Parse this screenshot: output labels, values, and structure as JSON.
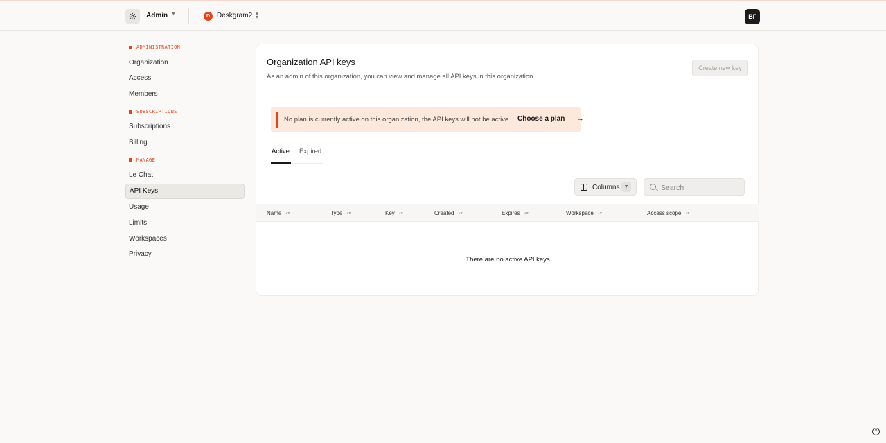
{
  "header": {
    "workspace_label": "Admin",
    "org_initial": "D",
    "org_name": "Deskgram2",
    "user_initials": "ВГ",
    "accent_color": "#e8421b"
  },
  "sidebar": {
    "sections": [
      {
        "title": "ADMINISTRATION",
        "items": [
          "Organization",
          "Access",
          "Members"
        ]
      },
      {
        "title": "SUBSCRIPTIONS",
        "items": [
          "Subscriptions",
          "Billing"
        ]
      },
      {
        "title": "MANAGE",
        "items": [
          "Le Chat",
          "API Keys",
          "Usage",
          "Limits",
          "Workspaces",
          "Privacy"
        ]
      }
    ],
    "active_item": "API Keys"
  },
  "main": {
    "title": "Organization API keys",
    "subtitle": "As an admin of this organization, you can view and manage all API keys in this organization.",
    "create_button": "Create new key",
    "alert": {
      "text": "No plan is currently active on this organization, the API keys will not be active.",
      "link": "Choose a plan"
    },
    "tabs": [
      "Active",
      "Expired"
    ],
    "active_tab": "Active",
    "columns_button": "Columns",
    "columns_count": "7",
    "search_placeholder": "Search",
    "table": {
      "headers": [
        "Name",
        "Type",
        "Key",
        "Created",
        "Expires",
        "Workspace",
        "Access scope"
      ],
      "empty_message": "There are no active API keys"
    }
  }
}
